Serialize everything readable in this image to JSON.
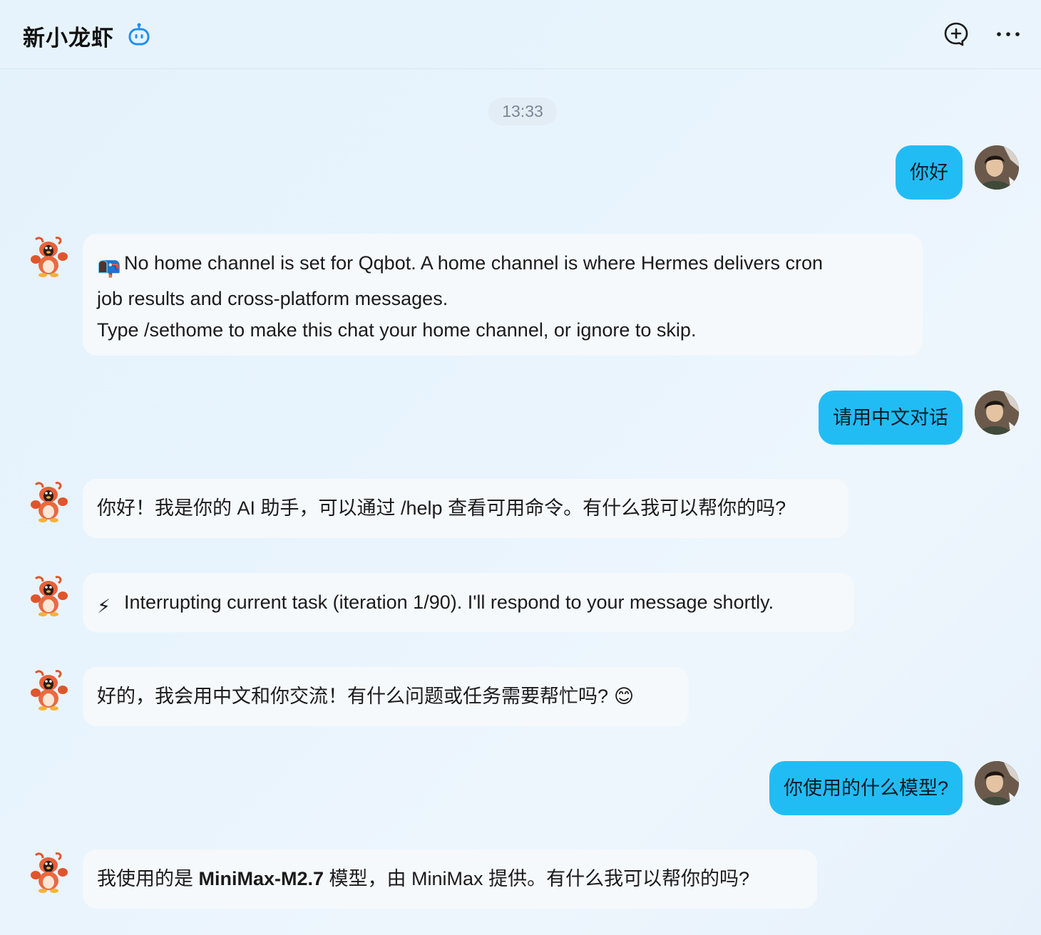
{
  "header": {
    "title": "新小龙虾",
    "bot_icon": "robot-icon",
    "new_chat_icon": "add-chat-icon",
    "more_icon": "more-icon"
  },
  "timestamp": "13:33",
  "colors": {
    "user_bubble": "#22bcf5",
    "bot_bubble": "#f5f9fc",
    "accent": "#1e8ff5"
  },
  "messages": [
    {
      "role": "user",
      "text": "你好"
    },
    {
      "role": "bot",
      "emoji": "📭",
      "lines": [
        "No home channel is set for Qqbot. A home channel is where Hermes delivers cron",
        "job results and cross-platform messages.",
        "Type /sethome to make this chat your home channel, or ignore to skip."
      ]
    },
    {
      "role": "user",
      "text": "请用中文对话"
    },
    {
      "role": "bot",
      "text": "你好！我是你的 AI 助手，可以通过 /help 查看可用命令。有什么我可以帮你的吗?"
    },
    {
      "role": "bot",
      "emoji": "⚡",
      "text": "Interrupting current task (iteration 1/90). I'll respond to your message shortly."
    },
    {
      "role": "bot",
      "text": "好的，我会用中文和你交流！有什么问题或任务需要帮忙吗?",
      "emoji_after": "😊"
    },
    {
      "role": "user",
      "text": "你使用的什么模型?"
    },
    {
      "role": "bot",
      "text_before": "我使用的是 ",
      "text_bold": "MiniMax-M2.7",
      "text_after": " 模型，由 MiniMax 提供。有什么我可以帮你的吗?"
    }
  ]
}
